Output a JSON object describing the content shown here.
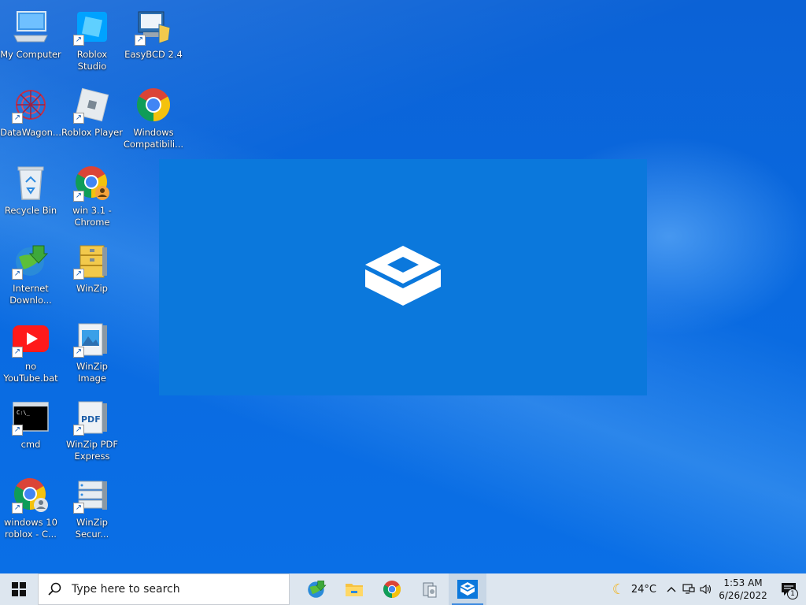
{
  "desktop": {
    "icons": [
      {
        "label": "My Computer",
        "icon": "computer-icon",
        "shortcut": false
      },
      {
        "label": "Roblox Studio",
        "icon": "roblox-studio-icon",
        "shortcut": true
      },
      {
        "label": "EasyBCD 2.4",
        "icon": "easybcd-icon",
        "shortcut": true
      },
      {
        "label": "DataWagon...",
        "icon": "datawagon-icon",
        "shortcut": true
      },
      {
        "label": "Roblox Player",
        "icon": "roblox-player-icon",
        "shortcut": true
      },
      {
        "label": "Windows Compatibili...",
        "icon": "chrome-icon",
        "shortcut": false
      },
      {
        "label": "Recycle Bin",
        "icon": "recycle-bin-icon",
        "shortcut": false
      },
      {
        "label": "win 3.1 - Chrome",
        "icon": "chrome-profile-icon",
        "shortcut": true
      },
      {
        "label": "Internet Downlo...",
        "icon": "internet-download-manager-icon",
        "shortcut": true
      },
      {
        "label": "WinZip",
        "icon": "winzip-icon",
        "shortcut": true
      },
      {
        "label": "no YouTube.bat",
        "icon": "youtube-icon",
        "shortcut": true
      },
      {
        "label": "WinZip Image Manager",
        "icon": "winzip-image-manager-icon",
        "shortcut": true
      },
      {
        "label": "cmd",
        "icon": "cmd-icon",
        "shortcut": true
      },
      {
        "label": "WinZip PDF Express",
        "icon": "winzip-pdf-icon",
        "shortcut": true
      },
      {
        "label": "windows 10 roblox - C...",
        "icon": "chrome-profile-icon",
        "shortcut": true
      },
      {
        "label": "WinZip Secur...",
        "icon": "winzip-secure-icon",
        "shortcut": true
      }
    ]
  },
  "splash": {
    "icon": "sandbox-icon"
  },
  "taskbar": {
    "search_placeholder": "Type here to search",
    "apps": [
      {
        "icon": "internet-download-manager-icon",
        "active": false
      },
      {
        "icon": "file-explorer-icon",
        "active": false
      },
      {
        "icon": "chrome-icon",
        "active": false
      },
      {
        "icon": "system-properties-icon",
        "active": false
      },
      {
        "icon": "sandbox-icon",
        "active": true
      }
    ],
    "weather": {
      "icon": "moon-icon",
      "temperature": "24°C"
    },
    "time": "1:53 AM",
    "date": "6/26/2022",
    "notification_count": "1"
  },
  "colors": {
    "accent": "#0078d7",
    "wallpaper": "#0a64d8",
    "taskbar": "#dde6ef"
  }
}
